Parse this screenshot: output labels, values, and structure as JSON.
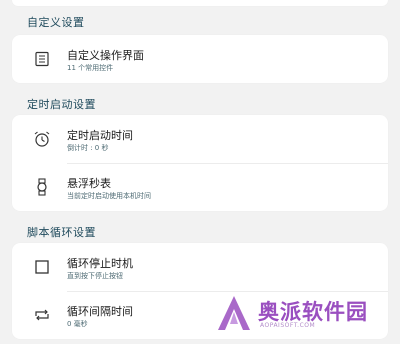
{
  "sections": [
    {
      "title": "自定义设置",
      "items": [
        {
          "title": "自定义操作界面",
          "subtitle": "11 个常用控件",
          "icon": "layout-list-icon"
        }
      ]
    },
    {
      "title": "定时启动设置",
      "items": [
        {
          "title": "定时启动时间",
          "subtitle": "倒计时 : 0 秒",
          "icon": "alarm-clock-icon"
        },
        {
          "title": "悬浮秒表",
          "subtitle": "当前定时启动使用本机时间",
          "icon": "watch-icon"
        }
      ]
    },
    {
      "title": "脚本循环设置",
      "items": [
        {
          "title": "循环停止时机",
          "subtitle": "直到按下停止按钮",
          "icon": "stop-square-icon"
        },
        {
          "title": "循环间隔时间",
          "subtitle": "0 毫秒",
          "icon": "repeat-icon"
        }
      ]
    }
  ],
  "watermark": {
    "text": "奥派软件园",
    "url": "AOPAISOFT.COM"
  },
  "colors": {
    "background": "#f2f2f2",
    "card": "#ffffff",
    "section_title": "#1f4a5c",
    "subtitle": "#4d6a73",
    "watermark": "#9a4fc0"
  }
}
